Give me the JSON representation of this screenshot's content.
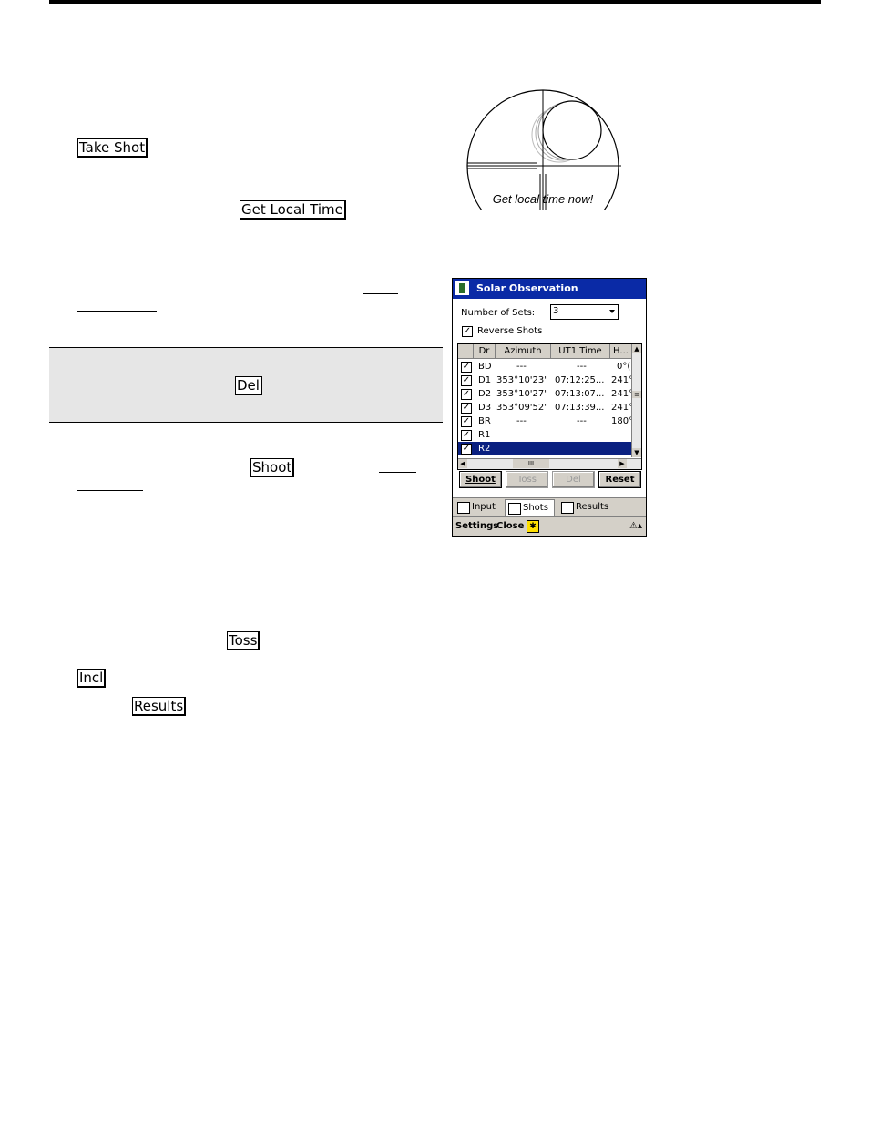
{
  "doc": {
    "take_shot": "Take Shot",
    "get_local_time": "Get Local Time",
    "del": "Del",
    "shoot": "Shoot",
    "toss": "Toss",
    "incl": "Incl",
    "results": "Results"
  },
  "figure": {
    "caption": "Get local time now!"
  },
  "pda": {
    "title": "Solar Observation",
    "sets_label": "Number of Sets:",
    "sets_value": "3",
    "reverse_label": "Reverse Shots",
    "columns": [
      "Dr",
      "Azimuth",
      "UT1 Time",
      "H..."
    ],
    "rows": [
      {
        "dr": "BD",
        "az": "---",
        "time": "---",
        "h": "0°("
      },
      {
        "dr": "D1",
        "az": "353°10'23\"",
        "time": "07:12:25...",
        "h": "241°"
      },
      {
        "dr": "D2",
        "az": "353°10'27\"",
        "time": "07:13:07...",
        "h": "241°"
      },
      {
        "dr": "D3",
        "az": "353°09'52\"",
        "time": "07:13:39...",
        "h": "241°"
      },
      {
        "dr": "BR",
        "az": "---",
        "time": "---",
        "h": "180°"
      },
      {
        "dr": "R1",
        "az": "",
        "time": "",
        "h": ""
      },
      {
        "dr": "R2",
        "az": "",
        "time": "",
        "h": ""
      }
    ],
    "buttons": {
      "shoot": "Shoot",
      "toss": "Toss",
      "del": "Del",
      "reset": "Reset"
    },
    "tabs": {
      "input": "Input",
      "shots": "Shots",
      "results": "Results"
    },
    "menu": {
      "settings": "Settings",
      "close": "Close"
    },
    "colors": {
      "titlebar": "#0a2aa6",
      "selection": "#0a2080"
    }
  }
}
